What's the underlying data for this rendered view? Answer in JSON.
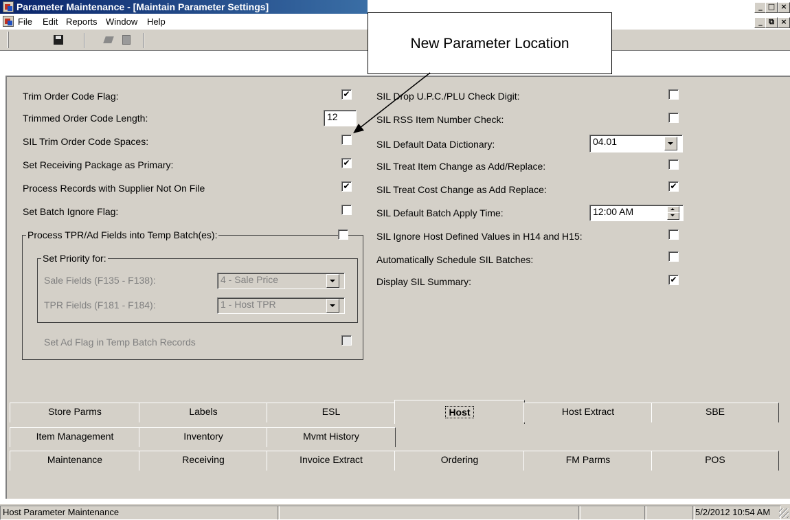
{
  "window": {
    "title": "Parameter Maintenance - [Maintain Parameter Settings]",
    "outer_buttons": [
      "_",
      "□",
      "×"
    ],
    "inner_buttons": [
      "_",
      "⧉",
      "×"
    ]
  },
  "menu": [
    "File",
    "Edit",
    "Reports",
    "Window",
    "Help"
  ],
  "callout": {
    "text": "New Parameter Location"
  },
  "left": {
    "trim_flag": {
      "label": "Trim Order Code Flag:",
      "checked": "✔"
    },
    "trim_len": {
      "label": "Trimmed Order Code Length:",
      "value": "12"
    },
    "sil_trim_spaces": {
      "label": "SIL Trim Order Code Spaces:",
      "checked": ""
    },
    "recv_pkg": {
      "label": "Set Receiving Package as Primary:",
      "checked": "✔"
    },
    "proc_supplier": {
      "label": "Process Records with Supplier Not On File",
      "checked": "✔"
    },
    "batch_ignore": {
      "label": "Set Batch Ignore Flag:",
      "checked": ""
    },
    "tpr_group": {
      "label": "Process TPR/Ad Fields into Temp Batch(es):",
      "checked": ""
    },
    "priority_group": {
      "label": "Set Priority for:"
    },
    "sale_fields": {
      "label": "Sale Fields (F135 - F138):",
      "value": "4 - Sale Price"
    },
    "tpr_fields": {
      "label": "TPR Fields (F181 - F184):",
      "value": "1 - Host TPR"
    },
    "ad_flag": {
      "label": "Set Ad Flag in Temp Batch Records",
      "checked": ""
    }
  },
  "right": {
    "drop_upc": {
      "label": "SIL Drop U.P.C./PLU Check Digit:",
      "checked": ""
    },
    "rss_item": {
      "label": "SIL RSS Item Number Check:",
      "checked": ""
    },
    "data_dict": {
      "label": "SIL Default Data Dictionary:",
      "value": "04.01"
    },
    "item_change": {
      "label": "SIL Treat Item Change as Add/Replace:",
      "checked": ""
    },
    "cost_change": {
      "label": "SIL Treat Cost Change as Add Replace:",
      "checked": "✔"
    },
    "apply_time": {
      "label": "SIL Default Batch Apply Time:",
      "value": "12:00 AM"
    },
    "ignore_host": {
      "label": "SIL Ignore Host Defined Values in H14 and H15:",
      "checked": ""
    },
    "auto_schedule": {
      "label": "Automatically Schedule SIL Batches:",
      "checked": ""
    },
    "summary": {
      "label": "Display SIL Summary:",
      "checked": "✔"
    }
  },
  "tabs": {
    "row1": [
      "Store Parms",
      "Labels",
      "ESL",
      "Host",
      "Host Extract",
      "SBE"
    ],
    "row2": [
      "Item Management",
      "Inventory",
      "Mvmt History"
    ],
    "row3": [
      "Maintenance",
      "Receiving",
      "Invoice Extract",
      "Ordering",
      "FM Parms",
      "POS"
    ],
    "selected": "Host"
  },
  "status": {
    "text": "Host Parameter Maintenance",
    "datetime": "5/2/2012 10:54 AM"
  }
}
